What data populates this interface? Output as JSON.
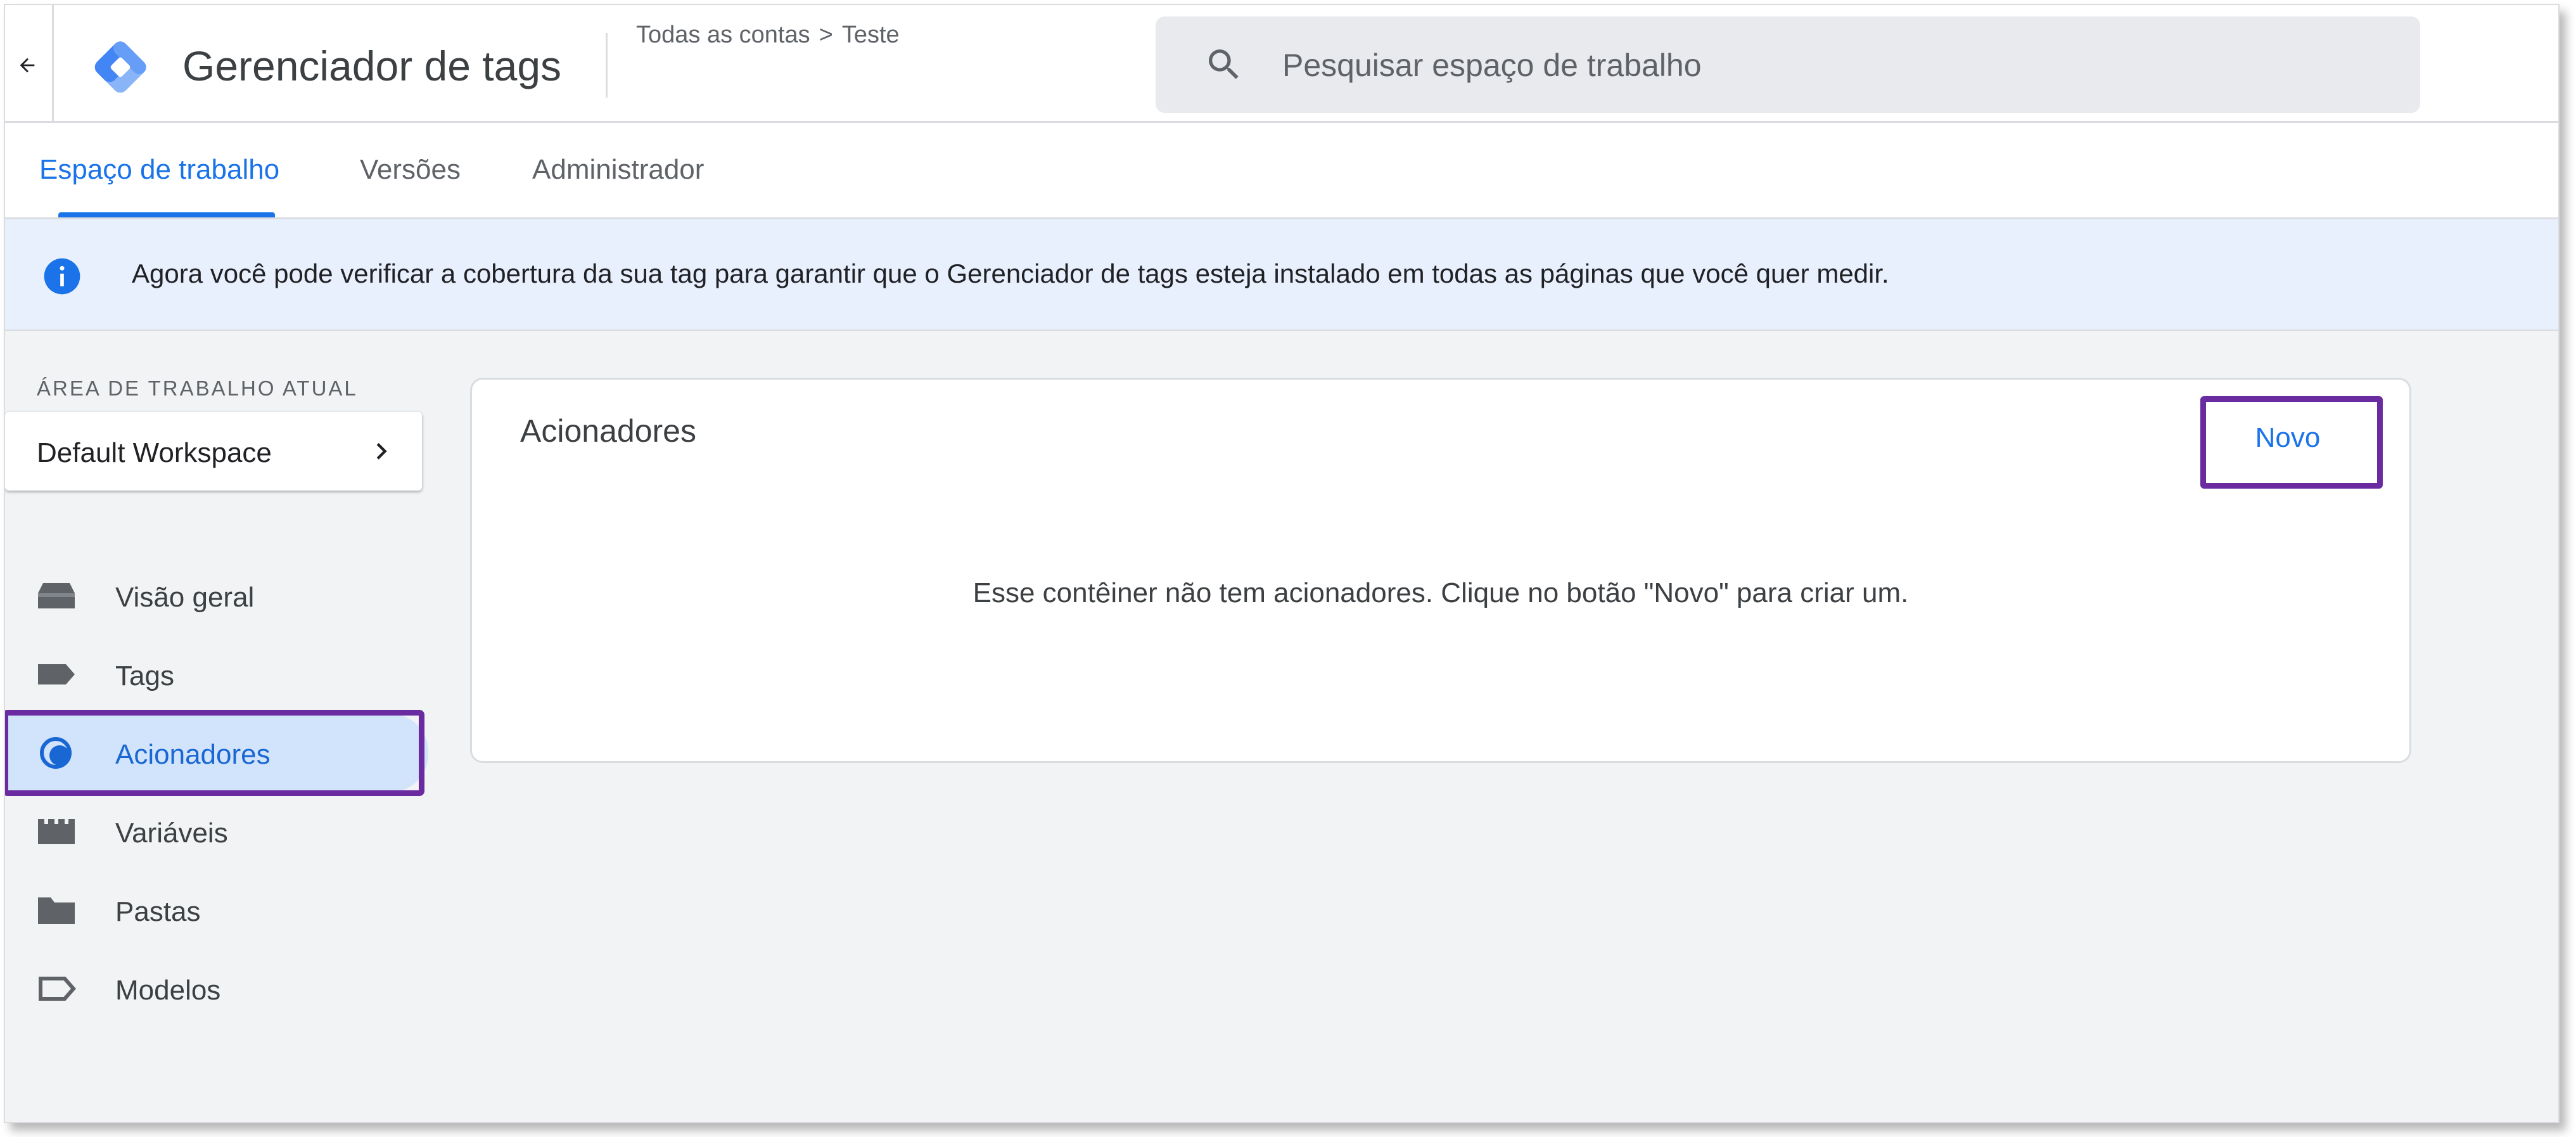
{
  "header": {
    "back_icon": "arrow-back-icon",
    "logo_icon": "tag-manager-logo",
    "title": "Gerenciador de tags",
    "breadcrumb": {
      "account": "Todas as contas",
      "separator": ">",
      "container": "Teste"
    },
    "search": {
      "placeholder": "Pesquisar espaço de trabalho",
      "value": "",
      "icon": "search-icon"
    }
  },
  "tabs": [
    {
      "label": "Espaço de trabalho",
      "active": true
    },
    {
      "label": "Versões",
      "active": false
    },
    {
      "label": "Administrador",
      "active": false
    }
  ],
  "banner": {
    "icon": "info-icon",
    "text": "Agora você pode verificar a cobertura da sua tag para garantir que o Gerenciador de tags esteja instalado em todas as páginas que você quer medir."
  },
  "sidebar": {
    "workspace_label": "ÁREA DE TRABALHO ATUAL",
    "workspace_name": "Default Workspace",
    "items": [
      {
        "label": "Visão geral",
        "icon": "overview-icon",
        "active": false
      },
      {
        "label": "Tags",
        "icon": "tag-icon",
        "active": false
      },
      {
        "label": "Acionadores",
        "icon": "trigger-icon",
        "active": true
      },
      {
        "label": "Variáveis",
        "icon": "variables-icon",
        "active": false
      },
      {
        "label": "Pastas",
        "icon": "folder-icon",
        "active": false
      },
      {
        "label": "Modelos",
        "icon": "templates-icon",
        "active": false
      }
    ]
  },
  "main": {
    "title": "Acionadores",
    "new_button": "Novo",
    "empty_message": "Esse contêiner não tem acionadores. Clique no botão \"Novo\" para criar um."
  },
  "colors": {
    "accent": "#1a73e8",
    "highlight": "#6a2aa0",
    "banner_bg": "#e8f0fe",
    "active_nav_bg": "#d2e3fc",
    "page_bg": "#f1f3f4"
  }
}
